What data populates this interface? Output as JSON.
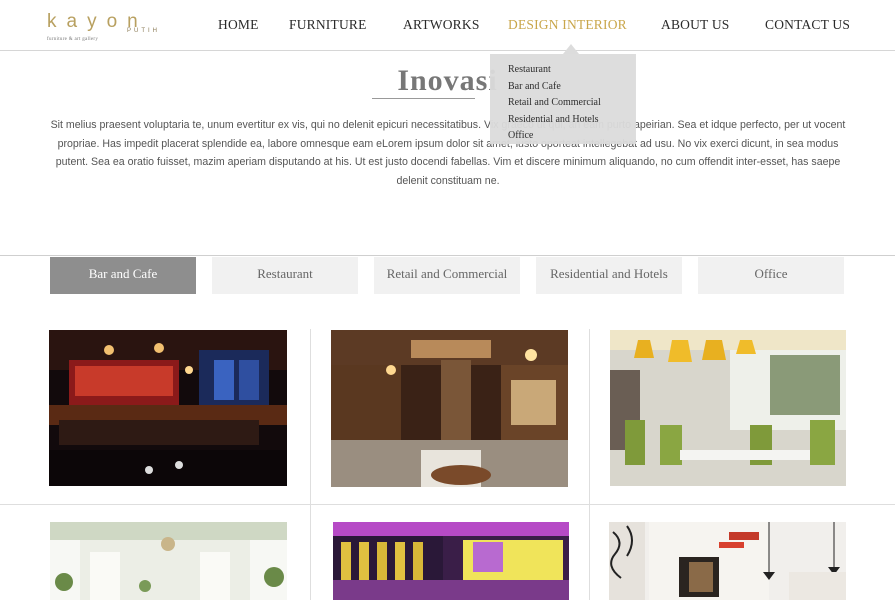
{
  "logo": {
    "wordmark": "kayon",
    "sub": "PUTIH",
    "tagline": "furniture & art gallery"
  },
  "nav": {
    "items": [
      {
        "label": "HOME"
      },
      {
        "label": "FURNITURE"
      },
      {
        "label": "ARTWORKS"
      },
      {
        "label": "DESIGN INTERIOR"
      },
      {
        "label": "ABOUT US"
      },
      {
        "label": "CONTACT US"
      }
    ],
    "active_index": 3,
    "active_color": "#c9a64a"
  },
  "dropdown": {
    "items": [
      "Restaurant",
      "Bar and Cafe",
      "Retail and Commercial",
      "Residential and Hotels",
      "Office"
    ]
  },
  "page": {
    "title": "Inovasi",
    "intro": "Sit melius praesent voluptaria te, unum evertitur ex vis, qui no delenit epicuri necessitatibus. Vix graeco ut qui, an eam purto apeirian. Sea et idque perfecto, per ut vocent propriae. Has impedit placerat splendide ea, labore omnesque eam eLorem ipsum dolor sit amet, iusto oporteat intellegebat ad usu. No vix exerci dicunt, in sea modus putent. Sea ea oratio fuisset, mazim aperiam disputando at his. Ut est justo docendi fabellas. Vim et discere minimum aliquando, no cum offendit inter-esset, has saepe delenit constituam ne."
  },
  "tabs": {
    "items": [
      "Bar and Cafe",
      "Restaurant",
      "Retail and Commercial",
      "Residential and Hotels",
      "Office"
    ],
    "active_index": 0,
    "active_color": "#8e8e8e"
  },
  "gallery": {
    "images": [
      {
        "name": "bar-interior-red-lights"
      },
      {
        "name": "classic-pub-interior"
      },
      {
        "name": "garden-dining-yellow-lamps"
      },
      {
        "name": "white-hall-interior"
      },
      {
        "name": "purple-lounge-interior"
      },
      {
        "name": "modern-white-cafe"
      }
    ]
  }
}
